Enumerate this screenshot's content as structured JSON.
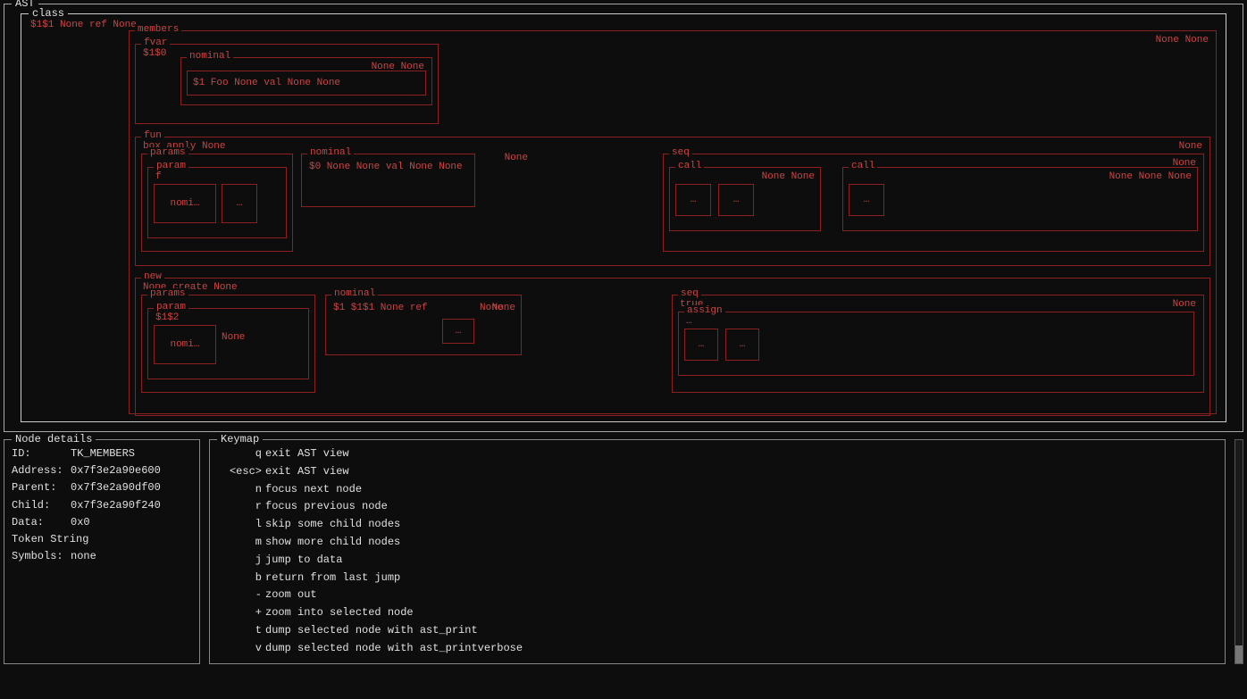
{
  "ast": {
    "title": "AST",
    "class_label": "class",
    "class_text": "$1$1 None ref None",
    "members_label": "members",
    "members_right_text": "None None",
    "fvar_label": "fvar",
    "fvar_text": "$1$0",
    "nominal1_label": "nominal",
    "nominal1_text": "None None",
    "nominal1_inner": "$1 Foo None val None None",
    "fun_label": "fun",
    "fun_text": "box apply None",
    "fun_right": "None",
    "params1_label": "params",
    "param1_label": "param",
    "param1_text": "f",
    "nomi1_label": "nomi…",
    "box1_label": "…",
    "nominal2_label": "nominal",
    "nominal2_text": "$0 None None val None None",
    "nominal2_right": "None",
    "seq1_label": "seq",
    "seq1_right": "None",
    "call1_label": "call",
    "call1_box1": "…",
    "call1_box2": "…",
    "call1_right": "None None",
    "call2_label": "call",
    "call2_box1": "…",
    "call2_right": "None None None",
    "new_label": "new",
    "new_text": "None create None",
    "params2_label": "params",
    "param2_label": "param",
    "param2_text": "$1$2",
    "nomi2_label": "nomi…",
    "nomi2_text": "None",
    "nominal3_label": "nominal",
    "nominal3_text": "$1 $1$1 None ref",
    "nominal3_box": "…",
    "nominal3_right": "None",
    "nominal3_right2": "None",
    "seq2_label": "seq",
    "seq2_text": "true",
    "seq2_right": "None",
    "assign_label": "assign",
    "assign_text": "…",
    "assign_box1": "…",
    "assign_box2": "…"
  },
  "node_details": {
    "title": "Node details",
    "id_label": "ID:",
    "id_val": "TK_MEMBERS",
    "address_label": "Address:",
    "address_val": "0x7f3e2a90e600",
    "parent_label": "Parent:",
    "parent_val": "0x7f3e2a90df00",
    "child_label": "Child:",
    "child_val": "0x7f3e2a90f240",
    "data_label": "Data:",
    "data_val": "0x0",
    "token_label": "Token String",
    "symbols_label": "Symbols:",
    "symbols_val": "none"
  },
  "keymap": {
    "title": "Keymap",
    "entries": [
      {
        "key": "q",
        "desc": "exit AST view"
      },
      {
        "key": "<esc>",
        "desc": "exit AST view"
      },
      {
        "key": "n",
        "desc": "focus next node"
      },
      {
        "key": "r",
        "desc": "focus previous node"
      },
      {
        "key": "l",
        "desc": "skip some child nodes"
      },
      {
        "key": "m",
        "desc": "show more child nodes"
      },
      {
        "key": "j",
        "desc": "jump to data"
      },
      {
        "key": "b",
        "desc": "return from last jump"
      },
      {
        "key": "-",
        "desc": "zoom out"
      },
      {
        "key": "+",
        "desc": "zoom into selected node"
      },
      {
        "key": "t",
        "desc": "dump selected node with ast_print"
      },
      {
        "key": "v",
        "desc": "dump selected node with ast_printverbose"
      }
    ]
  }
}
